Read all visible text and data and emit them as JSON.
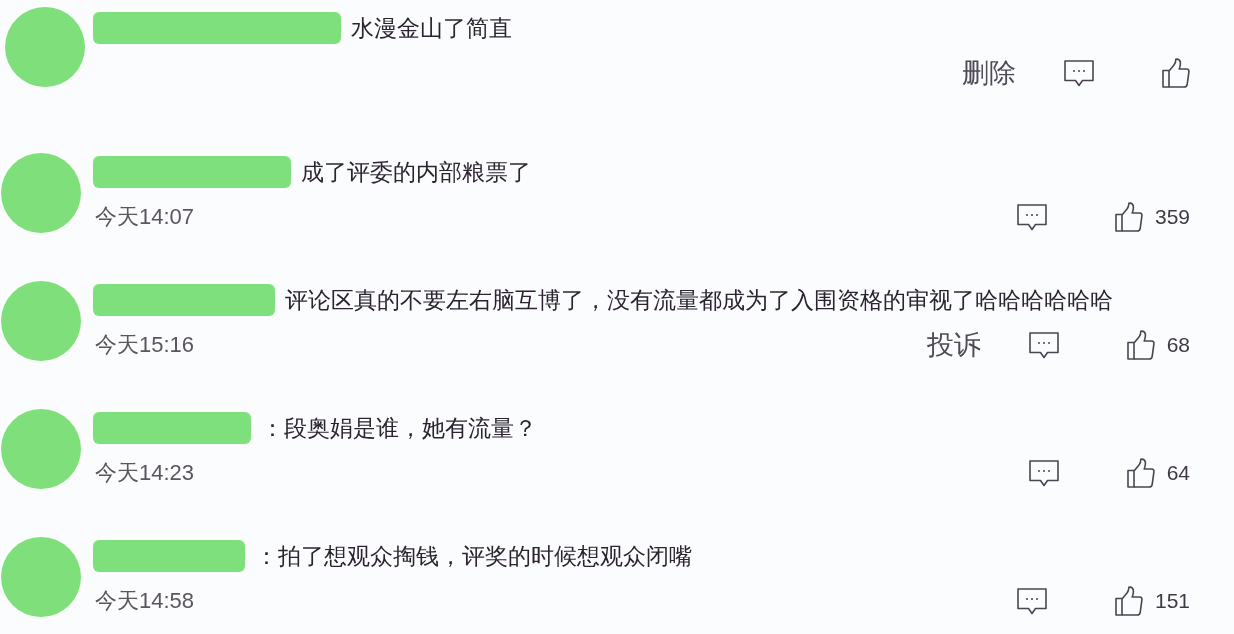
{
  "comments": [
    {
      "text": "水漫金山了简直",
      "action_link": "删除"
    },
    {
      "text": "成了评委的内部粮票了",
      "time": "今天14:07",
      "like_count": "359"
    },
    {
      "text": "评论区真的不要左右脑互博了，没有流量都成为了入围资格的审视了哈哈哈哈哈哈",
      "time": "今天15:16",
      "action_link": "投诉",
      "like_count": "68"
    },
    {
      "text": "：段奥娟是谁，她有流量？",
      "time": "今天14:23",
      "like_count": "64"
    },
    {
      "text": "：拍了想观众掏钱，评奖的时候想观众闭嘴",
      "time": "今天14:58",
      "like_count": "151"
    }
  ]
}
